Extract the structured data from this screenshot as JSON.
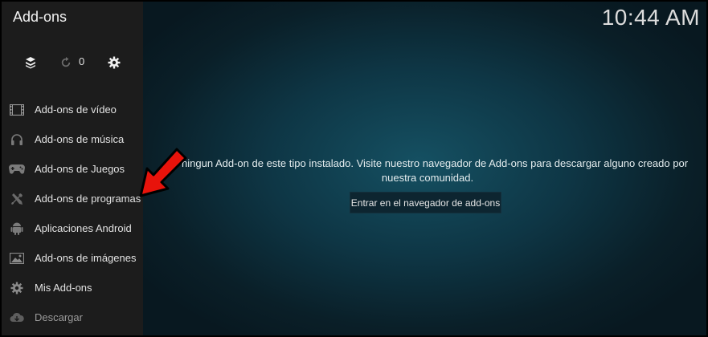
{
  "header": {
    "title": "Add-ons",
    "clock": "10:44 AM"
  },
  "toolbar": {
    "update_count": "0",
    "icons": [
      "box-stack-icon",
      "refresh-icon",
      "gear-icon"
    ]
  },
  "sidebar": {
    "items": [
      {
        "label": "Add-ons de vídeo",
        "icon": "film-icon"
      },
      {
        "label": "Add-ons de música",
        "icon": "headphones-icon"
      },
      {
        "label": "Add-ons de Juegos",
        "icon": "gamepad-icon"
      },
      {
        "label": "Add-ons de programas",
        "icon": "tools-icon"
      },
      {
        "label": "Aplicaciones Android",
        "icon": "android-icon"
      },
      {
        "label": "Add-ons de imágenes",
        "icon": "image-icon"
      },
      {
        "label": "Mis Add-ons",
        "icon": "gear-icon"
      },
      {
        "label": "Descargar",
        "icon": "cloud-download-icon"
      }
    ]
  },
  "main": {
    "message_line1": "ne ningun Add-on de este tipo instalado. Visite nuestro navegador de Add-ons para descargar alguno creado por",
    "message_line2": "nuestra comunidad.",
    "browse_button": "Entrar en el navegador de add-ons"
  },
  "colors": {
    "sidebar": "#1c1c1c",
    "background": "#0e3645",
    "arrow": "#e8130b"
  }
}
